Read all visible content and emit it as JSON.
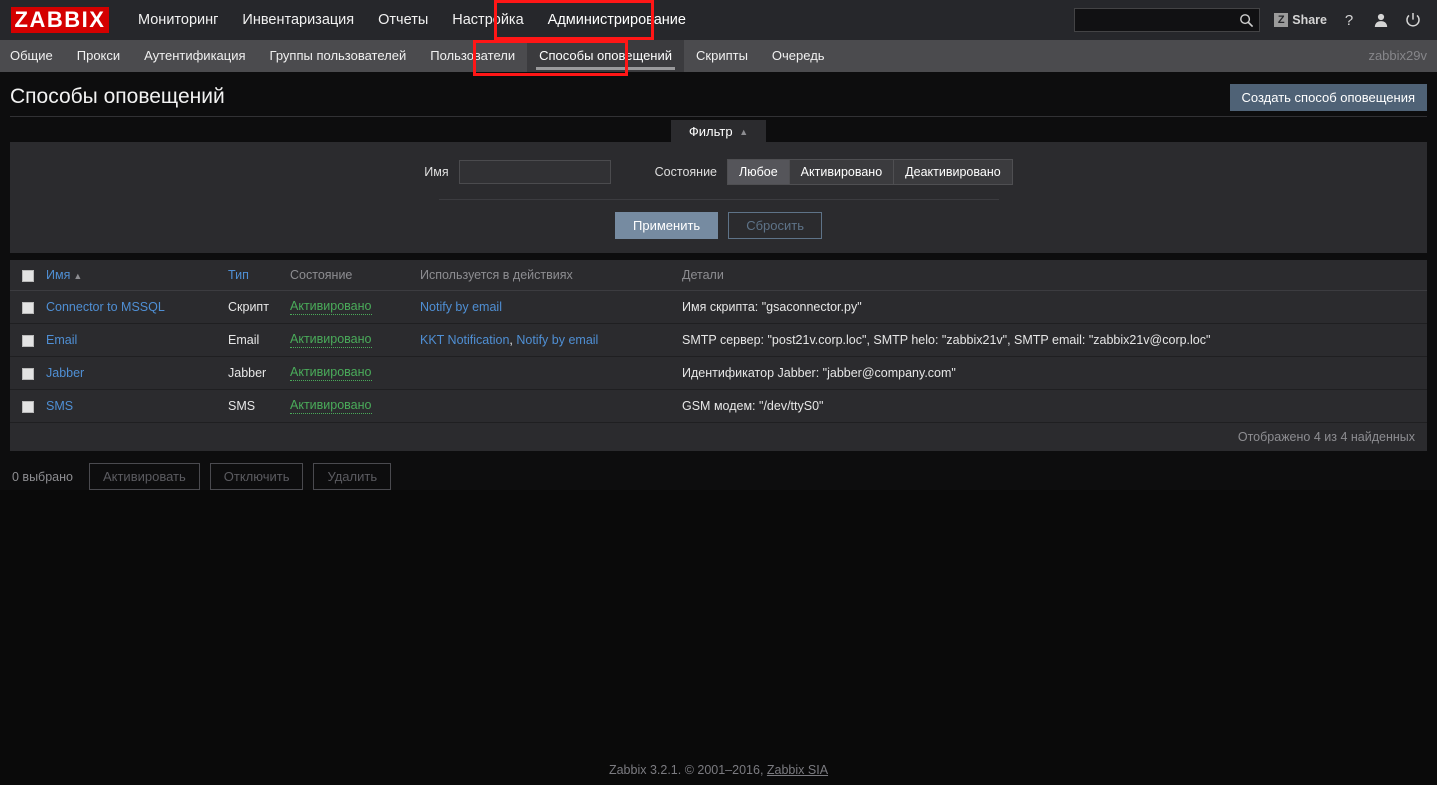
{
  "header": {
    "logo_text": "ZABBIX",
    "nav": [
      {
        "label": "Мониторинг",
        "active": false
      },
      {
        "label": "Инвентаризация",
        "active": false
      },
      {
        "label": "Отчеты",
        "active": false
      },
      {
        "label": "Настройка",
        "active": false
      },
      {
        "label": "Администрирование",
        "active": true
      }
    ],
    "search_value": "",
    "search_placeholder": "",
    "share_label": "Share",
    "share_badge": "Z",
    "help_icon": "question-mark-icon",
    "user_icon": "user-icon",
    "power_icon": "power-icon",
    "search_icon": "search-icon"
  },
  "subnav": {
    "items": [
      {
        "label": "Общие",
        "active": false
      },
      {
        "label": "Прокси",
        "active": false
      },
      {
        "label": "Аутентификация",
        "active": false
      },
      {
        "label": "Группы пользователей",
        "active": false
      },
      {
        "label": "Пользователи",
        "active": false
      },
      {
        "label": "Способы оповещений",
        "active": true
      },
      {
        "label": "Скрипты",
        "active": false
      },
      {
        "label": "Очередь",
        "active": false
      }
    ],
    "server_name": "zabbix29v"
  },
  "page": {
    "title": "Способы оповещений",
    "create_button": "Создать способ оповещения"
  },
  "filter": {
    "tab_label": "Фильтр",
    "tab_arrow": "▲",
    "name_label": "Имя",
    "name_value": "",
    "name_placeholder": "",
    "state_label": "Состояние",
    "state_options": [
      {
        "label": "Любое",
        "selected": true
      },
      {
        "label": "Активировано",
        "selected": false
      },
      {
        "label": "Деактивировано",
        "selected": false
      }
    ],
    "apply_button": "Применить",
    "reset_button": "Сбросить"
  },
  "table": {
    "columns": [
      {
        "label": "Имя",
        "sortable": true,
        "sorted": true,
        "sort_dir": "▲"
      },
      {
        "label": "Тип",
        "sortable": true,
        "sorted": false
      },
      {
        "label": "Состояние",
        "sortable": false
      },
      {
        "label": "Используется в действиях",
        "sortable": false
      },
      {
        "label": "Детали",
        "sortable": false
      }
    ],
    "rows": [
      {
        "name": "Connector to MSSQL",
        "type": "Скрипт",
        "state": "Активировано",
        "actions": [
          "Notify by email"
        ],
        "details": "Имя скрипта: \"gsaconnector.py\""
      },
      {
        "name": "Email",
        "type": "Email",
        "state": "Активировано",
        "actions": [
          "KKT Notification",
          "Notify by email"
        ],
        "details": "SMTP сервер: \"post21v.corp.loc\", SMTP helo: \"zabbix21v\", SMTP email: \"zabbix21v@corp.loc\""
      },
      {
        "name": "Jabber",
        "type": "Jabber",
        "state": "Активировано",
        "actions": [],
        "details": "Идентификатор Jabber: \"jabber@company.com\""
      },
      {
        "name": "SMS",
        "type": "SMS",
        "state": "Активировано",
        "actions": [],
        "details": "GSM модем: \"/dev/ttyS0\""
      }
    ],
    "footer_count": "Отображено 4 из 4 найденных"
  },
  "bottom_actions": {
    "selected_label": "0 выбрано",
    "buttons": [
      {
        "label": "Активировать",
        "enabled": false
      },
      {
        "label": "Отключить",
        "enabled": false
      },
      {
        "label": "Удалить",
        "enabled": false
      }
    ]
  },
  "footer": {
    "text": "Zabbix 3.2.1. © 2001–2016, ",
    "link": "Zabbix SIA"
  },
  "colors": {
    "brand_red": "#d40000",
    "link_blue": "#4f8fd4",
    "state_green": "#4aab5a",
    "accent_button": "#4f6276",
    "apply_button": "#768ba1",
    "highlight_red": "#ff1616"
  }
}
